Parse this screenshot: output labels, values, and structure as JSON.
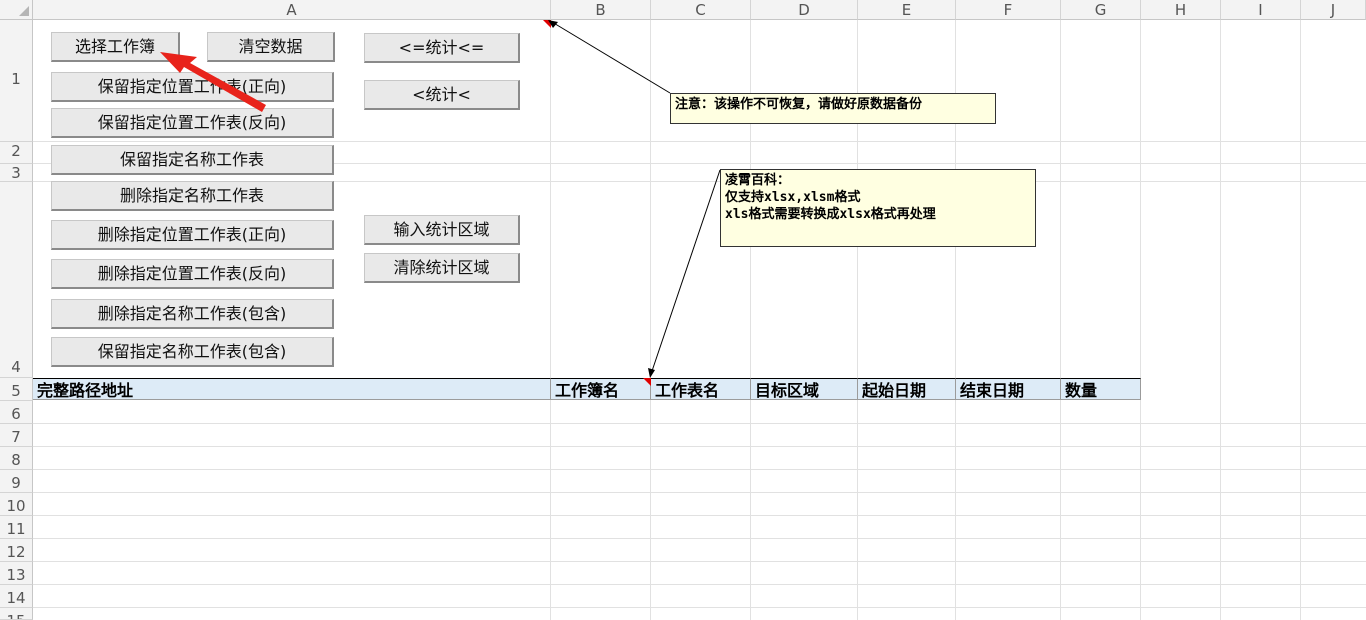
{
  "columns": [
    "A",
    "B",
    "C",
    "D",
    "E",
    "F",
    "G",
    "H",
    "I",
    "J"
  ],
  "rows": [
    "1",
    "2",
    "3",
    "4",
    "5",
    "6",
    "7",
    "8",
    "9",
    "10",
    "11",
    "12",
    "13",
    "14",
    "15"
  ],
  "buttons": {
    "select_workbook": "选择工作簿",
    "clear_data": "清空数据",
    "stat_left_arrows": "<=统计<=",
    "stat_left": "<统计<",
    "keep_pos_forward": "保留指定位置工作表(正向)",
    "keep_pos_reverse": "保留指定位置工作表(反向)",
    "keep_name": "保留指定名称工作表",
    "delete_name": "删除指定名称工作表",
    "delete_pos_forward": "删除指定位置工作表(正向)",
    "delete_pos_reverse": "删除指定位置工作表(反向)",
    "delete_name_contains": "删除指定名称工作表(包含)",
    "keep_name_contains": "保留指定名称工作表(包含)",
    "input_stat_range": "输入统计区域",
    "clear_stat_range": "清除统计区域"
  },
  "table_header": {
    "full_path": "完整路径地址",
    "workbook_name": "工作簿名",
    "worksheet_name": "工作表名",
    "target_range": "目标区域",
    "start_date": "起始日期",
    "end_date": "结束日期",
    "quantity": "数量"
  },
  "comments": {
    "warning": "注意：该操作不可恢复，请做好原数据备份",
    "info_line1": "凌霄百科：",
    "info_line2": "仅支持xlsx,xlsm格式",
    "info_line3": "xls格式需要转换成xlsx格式再处理"
  },
  "colors": {
    "header_fill": "#ddebf7",
    "comment_fill": "#ffffe1",
    "arrow_red": "#e8231b",
    "marker_red": "#e00000"
  }
}
